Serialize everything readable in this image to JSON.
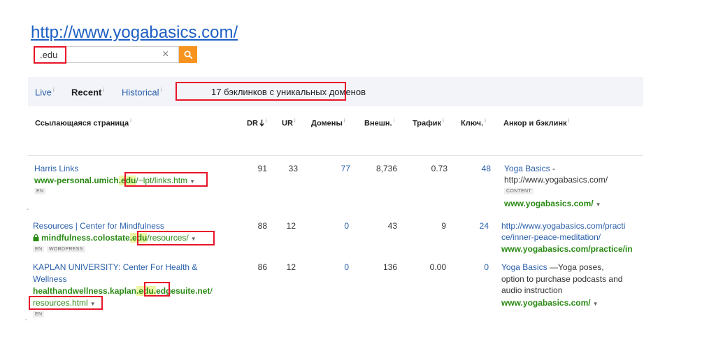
{
  "site_url": "http://www.yogabasics.com/",
  "search": {
    "value": ".edu",
    "clear_icon": "×"
  },
  "tabs": [
    {
      "label": "Live"
    },
    {
      "label": "Recent"
    },
    {
      "label": "Historical"
    }
  ],
  "info_glyph": "i",
  "summary": "17 бэклинков с уникальных доменов",
  "columns": {
    "page": "Ссылающаяся страница",
    "dr": "DR",
    "ur": "UR",
    "domains": "Домены",
    "external": "Внешн.",
    "traffic": "Трафик",
    "keywords": "Ключ.",
    "anchor": "Анкор и бэклинк"
  },
  "rows": [
    {
      "title": "Harris Links",
      "url_host_pre": "www-personal.umich",
      "url_highlight": ".edu",
      "url_path": "/~lpt/links.htm",
      "tags": [
        "EN"
      ],
      "dr": "91",
      "ur": "33",
      "domains": "77",
      "external": "8,736",
      "traffic": "0.73",
      "keywords": "48",
      "anchor_title": "Yoga Basics",
      "anchor_rest": " -",
      "anchor_line2": "http://www.yogabasics.com/",
      "anchor_tag": "CONTENT",
      "backlink": "www.yogabasics.com/"
    },
    {
      "title": "Resources | Center for Mindfulness",
      "url_host_pre": "mindfulness.colostate",
      "url_highlight": ".edu",
      "url_path": "/resources/",
      "tags": [
        "EN",
        "WORDPRESS"
      ],
      "dr": "88",
      "ur": "12",
      "domains": "0",
      "external": "43",
      "traffic": "9",
      "keywords": "24",
      "anchor_line1": "http://www.yogabasics.com/practi",
      "anchor_line2": "ce/inner-peace-meditation/",
      "backlink": "www.yogabasics.com/practice/in"
    },
    {
      "title_line1": "KAPLAN UNIVERSITY: Center For Health &",
      "title_line2": "Wellness",
      "url_host_pre": "healthandwellness.kaplan",
      "url_highlight": ".edu.",
      "url_host_post": "edgesuite.net",
      "url_slash": "/",
      "url_path": "resources.html",
      "tags": [
        "EN"
      ],
      "dr": "86",
      "ur": "12",
      "domains": "0",
      "external": "136",
      "traffic": "0.00",
      "keywords": "0",
      "anchor_title": "Yoga Basics",
      "anchor_rest": " —Yoga poses,",
      "anchor_line2": "option to purchase podcasts and",
      "anchor_line3": "audio instruction",
      "backlink": "www.yogabasics.com/"
    }
  ],
  "colors": {
    "link": "#2a5faa",
    "green": "#2a8a14",
    "highlight_box": "#e8142a",
    "search_button": "#f79420"
  },
  "icons": [
    "search-icon",
    "clear-icon",
    "lock-icon",
    "sort-down-icon",
    "caret-down-icon",
    "info-icon"
  ]
}
